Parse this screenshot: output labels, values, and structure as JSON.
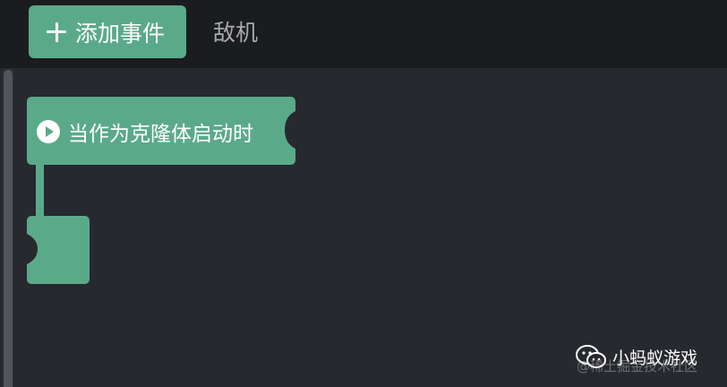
{
  "toolbar": {
    "add_event_label": "添加事件",
    "enemy_tab_label": "敌机"
  },
  "workspace": {
    "hat_block": {
      "label": "当作为克隆体启动时",
      "icon": "play-icon"
    },
    "empty_block": {}
  },
  "watermark": {
    "name": "小蚂蚁游戏",
    "sub": "@稀土掘金技术社区",
    "icon": "wechat-icon"
  },
  "colors": {
    "block_green": "#5aaa8a",
    "toolbar_bg": "#1b1c20",
    "workspace_bg": "#27292f"
  }
}
